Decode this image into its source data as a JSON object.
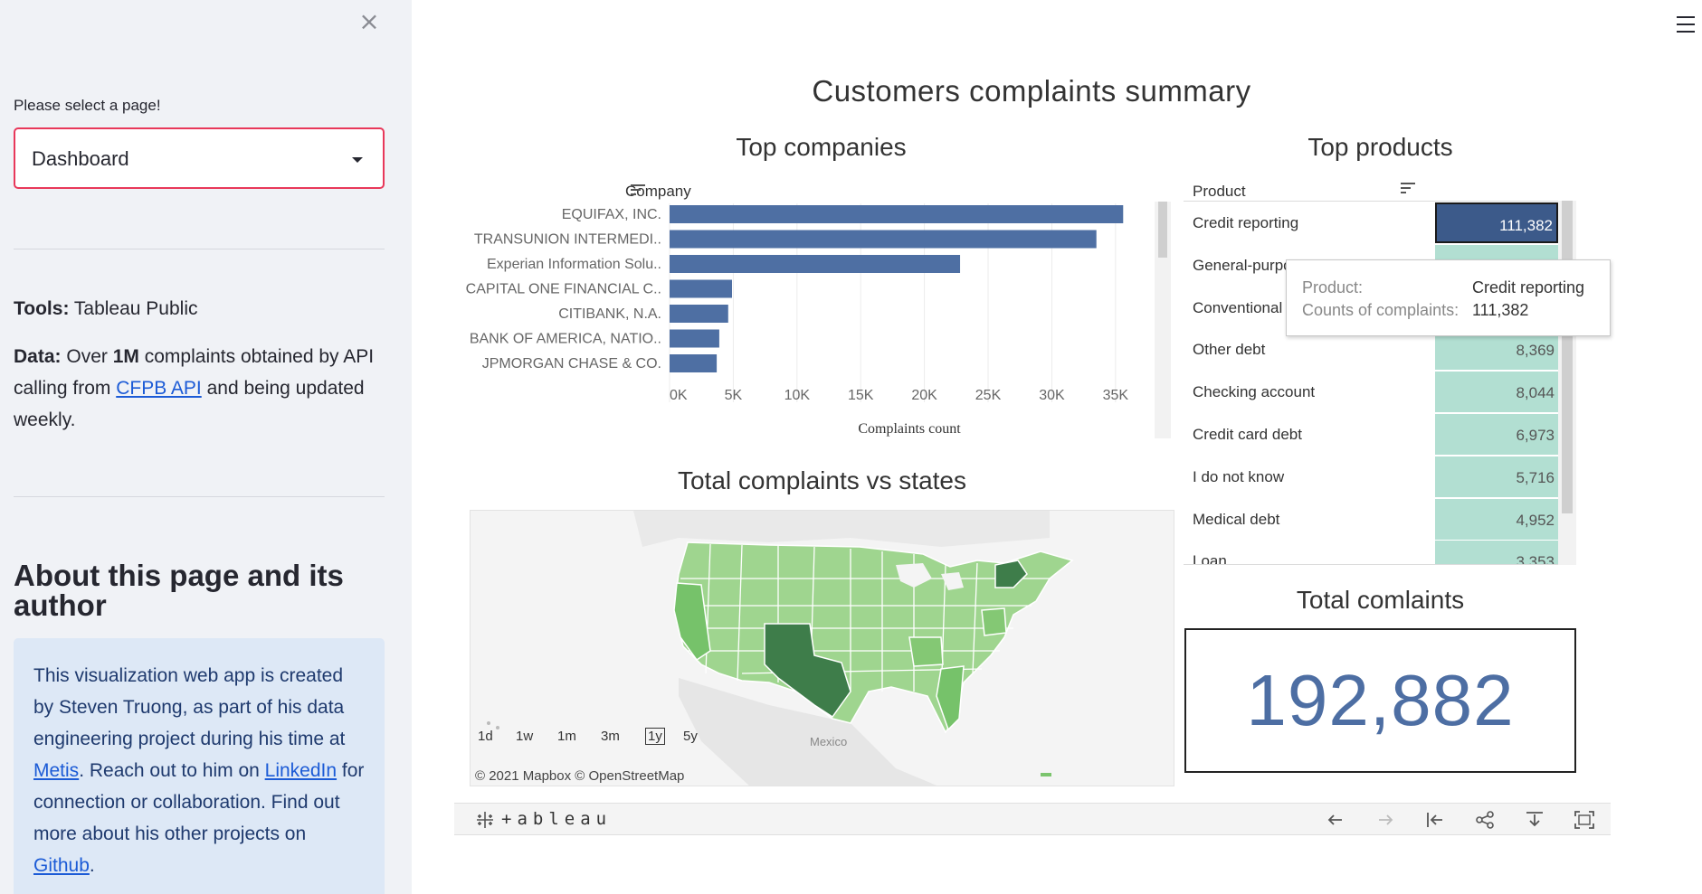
{
  "sidebar": {
    "close_label": "×",
    "select_label": "Please select a page!",
    "select_value": "Dashboard",
    "tools_label": "Tools:",
    "tools_value": "Tableau Public",
    "data_label": "Data:",
    "data_text_1": "Over",
    "data_bold": "1M",
    "data_text_2": "complaints obtained by API calling from",
    "data_link": "CFPB API",
    "data_text_3": "and being updated weekly.",
    "about_title": "About this page and its author",
    "about_text_1": "This visualization web app is created by Steven Truong, as part of his data engineering project during his time at",
    "about_link_metis": "Metis",
    "about_text_2": ". Reach out to him on",
    "about_link_linkedin": "LinkedIn",
    "about_text_3": "for connection or collaboration. Find out more about his other projects on",
    "about_link_github": "Github",
    "about_text_4": "."
  },
  "dashboard": {
    "title": "Customers complaints summary",
    "companies_title": "Top companies",
    "products_title": "Top products",
    "map_title": "Total complaints vs states",
    "total_title": "Total comlaints",
    "total_value": "192,882"
  },
  "chart_data": {
    "type": "bar",
    "orientation": "horizontal",
    "title": "Top companies",
    "ylabel": "Company",
    "xlabel": "Complaints count",
    "categories": [
      "EQUIFAX, INC.",
      "TRANSUNION INTERMEDI..",
      "Experian Information Solu..",
      "CAPITAL ONE FINANCIAL C..",
      "CITIBANK, N.A.",
      "BANK OF AMERICA, NATIO..",
      "JPMORGAN CHASE & CO."
    ],
    "values": [
      35600,
      33500,
      22800,
      4900,
      4600,
      3900,
      3700
    ],
    "xticks": [
      "0K",
      "5K",
      "10K",
      "15K",
      "20K",
      "25K",
      "30K",
      "35K"
    ],
    "xlim": [
      0,
      37000
    ],
    "color": "#4e6fa3",
    "grid": true
  },
  "products": {
    "header": "Product",
    "color_selected": "#3c5a8a",
    "color_cell": "#b2dfd2",
    "rows": [
      {
        "name": "Credit reporting",
        "value": "111,382",
        "selected": true
      },
      {
        "name": "General-purpo",
        "value": "",
        "selected": false
      },
      {
        "name": "Conventional l",
        "value": "",
        "selected": false
      },
      {
        "name": "Other debt",
        "value": "8,369",
        "selected": false
      },
      {
        "name": "Checking account",
        "value": "8,044",
        "selected": false
      },
      {
        "name": "Credit card debt",
        "value": "6,973",
        "selected": false
      },
      {
        "name": "I do not know",
        "value": "5,716",
        "selected": false
      },
      {
        "name": "Medical debt",
        "value": "4,952",
        "selected": false
      },
      {
        "name": "Loan",
        "value": "3,353",
        "selected": false
      }
    ]
  },
  "tooltip": {
    "product_key": "Product:",
    "product_value": "Credit reporting",
    "count_key": "Counts of complaints:",
    "count_value": "111,382"
  },
  "map": {
    "controls": [
      "1d",
      "1w",
      "1m",
      "3m",
      "1y",
      "5y"
    ],
    "active_control": "1y",
    "mexico_label": "Mexico",
    "attribution": "© 2021 Mapbox  © OpenStreetMap"
  },
  "toolbar": {
    "logo": "+ableau",
    "icons": [
      "undo-icon",
      "redo-icon",
      "revert-icon",
      "share-icon",
      "download-icon",
      "fullscreen-icon"
    ]
  }
}
